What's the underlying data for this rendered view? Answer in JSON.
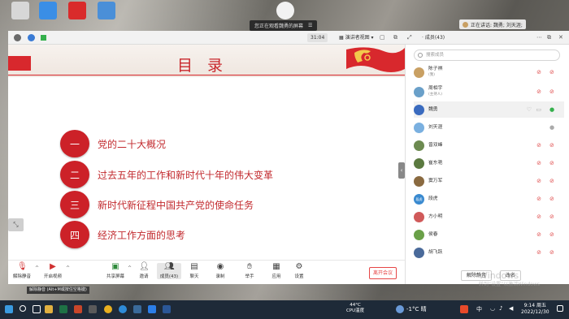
{
  "share_banner": {
    "text": "您正在观看魏勇的屏幕",
    "menu_icon": "menu-icon"
  },
  "speaking_indicator": {
    "text": "正在讲话: 魏勇; 刘天涯;"
  },
  "topbar": {
    "timer": "31:04",
    "view_mode": "演讲者视图",
    "members_title": "成员(43)"
  },
  "slide": {
    "title": "目 录",
    "items": [
      {
        "num": "一",
        "text": "党的二十大概况"
      },
      {
        "num": "二",
        "text": "过去五年的工作和新时代十年的伟大变革"
      },
      {
        "num": "三",
        "text": "新时代新征程中国共产党的使命任务"
      },
      {
        "num": "四",
        "text": "经济工作方面的思考"
      }
    ]
  },
  "panel": {
    "search_placeholder": "搜索成员",
    "members": [
      {
        "name": "陈子祺",
        "sub": "(我)",
        "avatar_color": "#c9a063"
      },
      {
        "name": "周相宇",
        "sub": "(主持人)",
        "avatar_color": "#6aa0c9"
      },
      {
        "name": "魏勇",
        "sub": "",
        "avatar_color": "#3a6bbf"
      },
      {
        "name": "刘天涯",
        "sub": "",
        "avatar_color": "#7ab0e0"
      },
      {
        "name": "曾双峰",
        "sub": "",
        "avatar_color": "#6c8a50"
      },
      {
        "name": "崔东艳",
        "sub": "",
        "avatar_color": "#5b7a40"
      },
      {
        "name": "窦万军",
        "sub": "",
        "avatar_color": "#8a6a40"
      },
      {
        "name": "段虎",
        "sub": "",
        "avatar_color": "#3a8ad0",
        "avatar_text": "段虎"
      },
      {
        "name": "方小明",
        "sub": "",
        "avatar_color": "#d05a5a"
      },
      {
        "name": "侯春",
        "sub": "",
        "avatar_color": "#6aa048"
      },
      {
        "name": "胡飞跃",
        "sub": "",
        "avatar_color": "#4a6a9a"
      }
    ],
    "unmute_all": "解除静音",
    "rename": "改名"
  },
  "toolbar": {
    "unmute": "解除静音",
    "video": "开启视频",
    "share": "共享屏幕",
    "invite": "邀请",
    "members": "成员(43)",
    "chat": "聊天",
    "record": "录制",
    "raise_hand": "举手",
    "apps": "应用",
    "settings": "设置",
    "leave": "离开会议"
  },
  "tooltip": "解除静音 (Alt+M或按住空格键)",
  "watermark": {
    "line1": "Windows",
    "line2": "转到“设置”以激活Windows"
  },
  "taskbar": {
    "temp": "44°C",
    "temp_label": "CPU温度",
    "weather": "-1°C 晴",
    "ime": "中",
    "time": "9:14 周五",
    "date": "2022/12/30"
  },
  "colors": {
    "accent_red": "#cc2128",
    "title_red": "#c9272c"
  }
}
